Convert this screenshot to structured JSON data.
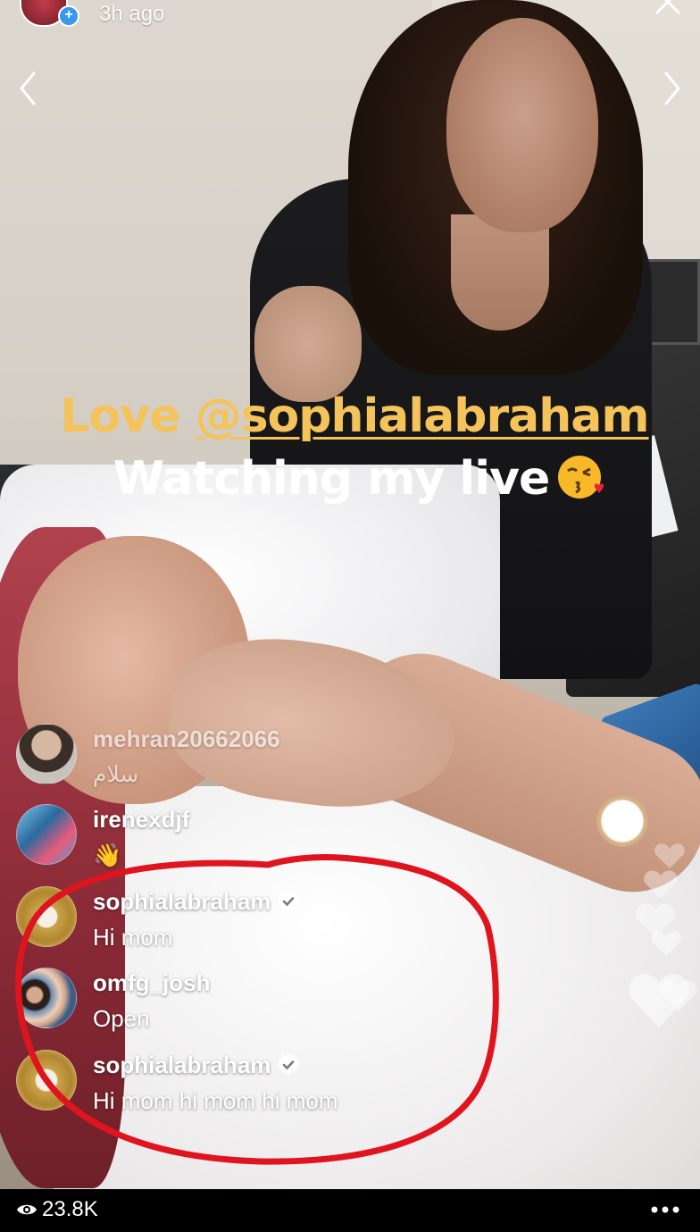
{
  "header": {
    "time_ago": "3h ago",
    "add_badge": "+"
  },
  "caption": {
    "line1_prefix": "Love ",
    "line1_mention": "@sophialabraham",
    "line2_text": "Watching my live",
    "line2_emoji": "kissing-face-with-heart-icon"
  },
  "comments": [
    {
      "username": "mehran20662066",
      "text": "سلام",
      "verified": false,
      "faded": true
    },
    {
      "username": "irenexdjf",
      "text": "👋",
      "verified": false,
      "faded": false
    },
    {
      "username": "sophialabraham",
      "text": "Hi mom",
      "verified": true,
      "faded": false
    },
    {
      "username": "omfg_josh",
      "text": "Open",
      "verified": false,
      "faded": false
    },
    {
      "username": "sophialabraham",
      "text": "Hi mom hi mom hi mom",
      "verified": true,
      "faded": false
    }
  ],
  "footer": {
    "viewer_count": "23.8K"
  },
  "colors": {
    "mention_yellow": "#f4c35a",
    "annotation_red": "#e0141e",
    "verified_blue": "#ffffff"
  }
}
